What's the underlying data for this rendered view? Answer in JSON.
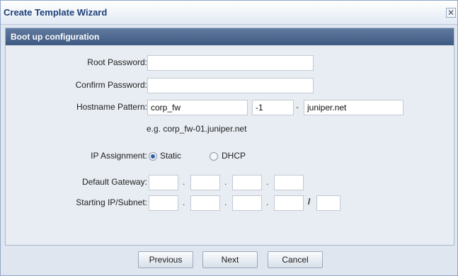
{
  "dialog": {
    "title": "Create Template Wizard",
    "close_glyph": "✕"
  },
  "section": {
    "title": "Boot up configuration"
  },
  "form": {
    "root_password": {
      "label": "Root Password:",
      "value": ""
    },
    "confirm_password": {
      "label": "Confirm Password:",
      "value": ""
    },
    "hostname": {
      "label": "Hostname Pattern:",
      "prefix": "corp_fw",
      "suffix": "-1",
      "separator": "-",
      "domain": "juniper.net",
      "example": "e.g. corp_fw-01.juniper.net"
    },
    "ip_assignment": {
      "label": "IP Assignment:",
      "options": [
        "Static",
        "DHCP"
      ],
      "selected": "Static"
    },
    "default_gateway": {
      "label": "Default Gateway:",
      "octets": [
        "",
        "",
        "",
        ""
      ],
      "dot": "."
    },
    "starting_ip": {
      "label": "Starting IP/Subnet:",
      "octets": [
        "",
        "",
        "",
        ""
      ],
      "dot": ".",
      "slash": "/",
      "mask": ""
    }
  },
  "footer": {
    "previous_label": "Previous",
    "next_label": "Next",
    "cancel_label": "Cancel"
  },
  "colors": {
    "header_bg": "#4a6590",
    "title_text": "#1e3f78",
    "panel_bg": "#e8edf3"
  }
}
